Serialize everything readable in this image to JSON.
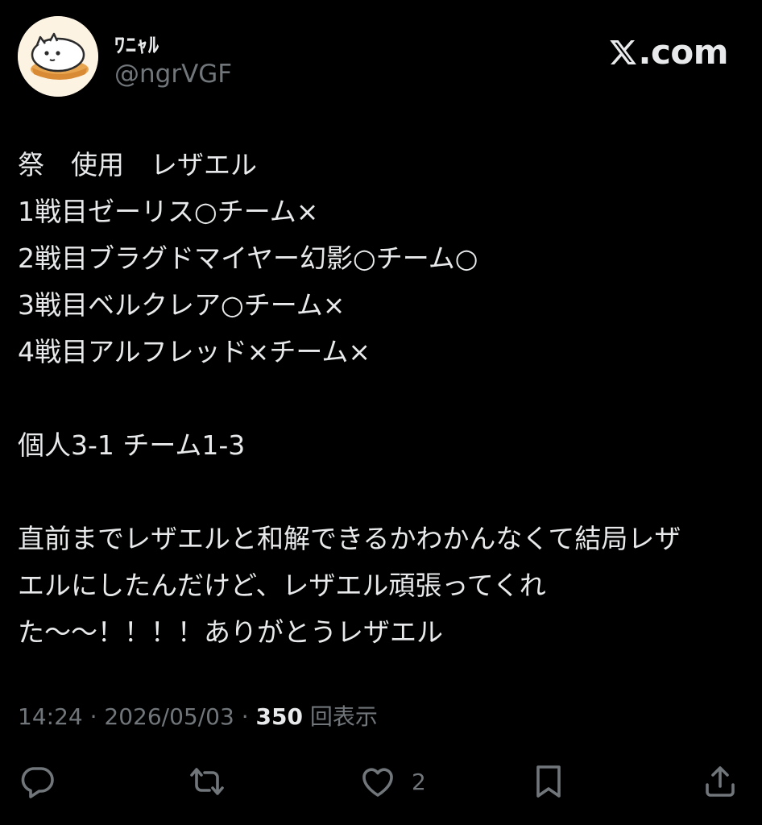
{
  "header": {
    "display_name": "ﾜﾆｬﾙ",
    "handle": "@ngrVGF",
    "brand": ".com",
    "brand_icon": "x-logo-icon",
    "avatar_icon": "cat-avatar-icon"
  },
  "tweet": {
    "lines": [
      "祭　使用　レザエル",
      "1戦目ゼーリス○チーム×",
      "2戦目ブラグドマイヤー幻影○チーム○",
      "3戦目ベルクレア○チーム×",
      "4戦目アルフレッド×チーム×",
      "",
      "個人3-1 チーム1-3",
      "",
      "直前までレザエルと和解できるかわかんなくて結局レザ",
      "エルにしたんだけど、レザエル頑張ってくれ",
      "た〜〜！！！！ありがとうレザエル"
    ]
  },
  "meta": {
    "time": "14:24",
    "separator": " · ",
    "date": "2026/05/03",
    "views_count": "350",
    "views_label": "回表示"
  },
  "actions": {
    "reply_icon": "reply-icon",
    "retweet_icon": "retweet-icon",
    "like_icon": "like-icon",
    "like_count": "2",
    "bookmark_icon": "bookmark-icon",
    "share_icon": "share-icon"
  },
  "colors": {
    "background": "#000000",
    "text": "#e7e9ea",
    "secondary": "#71767b"
  }
}
